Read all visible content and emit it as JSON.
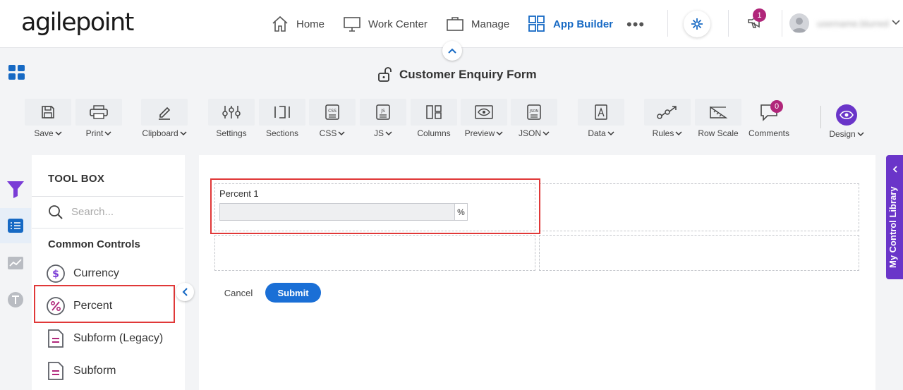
{
  "brand": {
    "logo_text": "agilepoint"
  },
  "nav": {
    "items": [
      {
        "label": "Home",
        "icon": "home-icon"
      },
      {
        "label": "Work Center",
        "icon": "monitor-icon"
      },
      {
        "label": "Manage",
        "icon": "briefcase-icon"
      },
      {
        "label": "App Builder",
        "icon": "grid-icon",
        "active": true
      }
    ],
    "more": "•••",
    "notifications_count": "1",
    "user_name": "username.blurred"
  },
  "app": {
    "form_title": "Customer Enquiry Form"
  },
  "toolbar": {
    "items": [
      {
        "label": "Save",
        "dropdown": true,
        "icon": "save-icon"
      },
      {
        "label": "Print",
        "dropdown": true,
        "icon": "print-icon"
      },
      {
        "label": "Clipboard",
        "dropdown": true,
        "icon": "pencil-icon"
      },
      {
        "label": "Settings",
        "dropdown": false,
        "icon": "sliders-icon"
      },
      {
        "label": "Sections",
        "dropdown": false,
        "icon": "sections-icon"
      },
      {
        "label": "CSS",
        "dropdown": true,
        "icon": "css-file-icon"
      },
      {
        "label": "JS",
        "dropdown": true,
        "icon": "js-file-icon"
      },
      {
        "label": "Columns",
        "dropdown": false,
        "icon": "columns-icon"
      },
      {
        "label": "Preview",
        "dropdown": true,
        "icon": "preview-icon"
      },
      {
        "label": "JSON",
        "dropdown": true,
        "icon": "json-file-icon"
      },
      {
        "label": "Data",
        "dropdown": true,
        "icon": "data-icon"
      },
      {
        "label": "Rules",
        "dropdown": true,
        "icon": "rules-icon"
      },
      {
        "label": "Row Scale",
        "dropdown": false,
        "icon": "ruler-icon"
      },
      {
        "label": "Comments",
        "dropdown": false,
        "icon": "comment-icon"
      }
    ],
    "comments_count": "0",
    "design_label": "Design"
  },
  "toolbox": {
    "title": "TOOL BOX",
    "search_placeholder": "Search...",
    "section_title": "Common Controls",
    "items": [
      {
        "label": "Currency",
        "icon": "currency-icon"
      },
      {
        "label": "Percent",
        "icon": "percent-icon"
      },
      {
        "label": "Subform (Legacy)",
        "icon": "subform-icon"
      },
      {
        "label": "Subform",
        "icon": "subform-icon"
      }
    ]
  },
  "form": {
    "percent_label": "Percent 1",
    "percent_value": "",
    "percent_suffix": "%",
    "cancel_label": "Cancel",
    "submit_label": "Submit"
  },
  "library": {
    "label": "My Control Library"
  },
  "colors": {
    "accent": "#1669c4",
    "purple": "#6a35c9",
    "magenta": "#b0267a",
    "highlight": "#e03838",
    "submit": "#1a6fd6"
  }
}
